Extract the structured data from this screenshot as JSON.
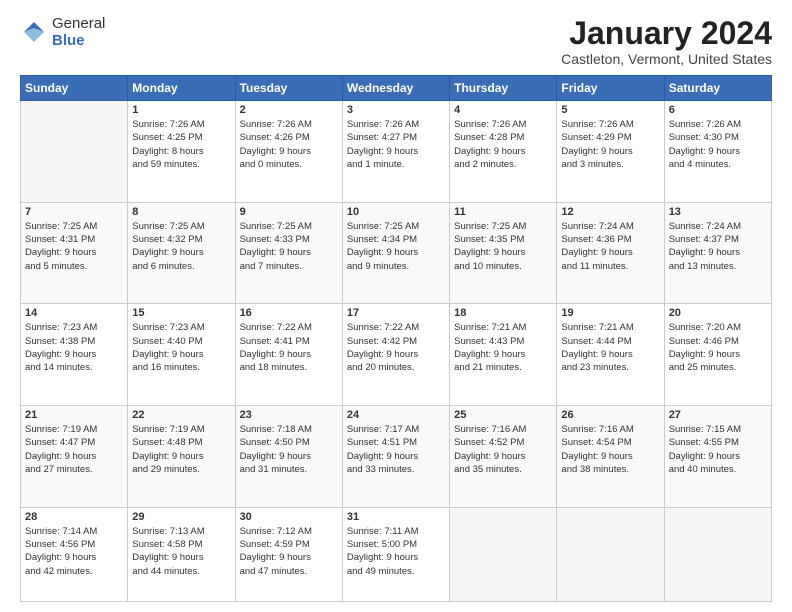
{
  "logo": {
    "general": "General",
    "blue": "Blue"
  },
  "title": "January 2024",
  "subtitle": "Castleton, Vermont, United States",
  "days_of_week": [
    "Sunday",
    "Monday",
    "Tuesday",
    "Wednesday",
    "Thursday",
    "Friday",
    "Saturday"
  ],
  "weeks": [
    [
      {
        "day": "",
        "info": ""
      },
      {
        "day": "1",
        "info": "Sunrise: 7:26 AM\nSunset: 4:25 PM\nDaylight: 8 hours\nand 59 minutes."
      },
      {
        "day": "2",
        "info": "Sunrise: 7:26 AM\nSunset: 4:26 PM\nDaylight: 9 hours\nand 0 minutes."
      },
      {
        "day": "3",
        "info": "Sunrise: 7:26 AM\nSunset: 4:27 PM\nDaylight: 9 hours\nand 1 minute."
      },
      {
        "day": "4",
        "info": "Sunrise: 7:26 AM\nSunset: 4:28 PM\nDaylight: 9 hours\nand 2 minutes."
      },
      {
        "day": "5",
        "info": "Sunrise: 7:26 AM\nSunset: 4:29 PM\nDaylight: 9 hours\nand 3 minutes."
      },
      {
        "day": "6",
        "info": "Sunrise: 7:26 AM\nSunset: 4:30 PM\nDaylight: 9 hours\nand 4 minutes."
      }
    ],
    [
      {
        "day": "7",
        "info": "Sunrise: 7:25 AM\nSunset: 4:31 PM\nDaylight: 9 hours\nand 5 minutes."
      },
      {
        "day": "8",
        "info": "Sunrise: 7:25 AM\nSunset: 4:32 PM\nDaylight: 9 hours\nand 6 minutes."
      },
      {
        "day": "9",
        "info": "Sunrise: 7:25 AM\nSunset: 4:33 PM\nDaylight: 9 hours\nand 7 minutes."
      },
      {
        "day": "10",
        "info": "Sunrise: 7:25 AM\nSunset: 4:34 PM\nDaylight: 9 hours\nand 9 minutes."
      },
      {
        "day": "11",
        "info": "Sunrise: 7:25 AM\nSunset: 4:35 PM\nDaylight: 9 hours\nand 10 minutes."
      },
      {
        "day": "12",
        "info": "Sunrise: 7:24 AM\nSunset: 4:36 PM\nDaylight: 9 hours\nand 11 minutes."
      },
      {
        "day": "13",
        "info": "Sunrise: 7:24 AM\nSunset: 4:37 PM\nDaylight: 9 hours\nand 13 minutes."
      }
    ],
    [
      {
        "day": "14",
        "info": "Sunrise: 7:23 AM\nSunset: 4:38 PM\nDaylight: 9 hours\nand 14 minutes."
      },
      {
        "day": "15",
        "info": "Sunrise: 7:23 AM\nSunset: 4:40 PM\nDaylight: 9 hours\nand 16 minutes."
      },
      {
        "day": "16",
        "info": "Sunrise: 7:22 AM\nSunset: 4:41 PM\nDaylight: 9 hours\nand 18 minutes."
      },
      {
        "day": "17",
        "info": "Sunrise: 7:22 AM\nSunset: 4:42 PM\nDaylight: 9 hours\nand 20 minutes."
      },
      {
        "day": "18",
        "info": "Sunrise: 7:21 AM\nSunset: 4:43 PM\nDaylight: 9 hours\nand 21 minutes."
      },
      {
        "day": "19",
        "info": "Sunrise: 7:21 AM\nSunset: 4:44 PM\nDaylight: 9 hours\nand 23 minutes."
      },
      {
        "day": "20",
        "info": "Sunrise: 7:20 AM\nSunset: 4:46 PM\nDaylight: 9 hours\nand 25 minutes."
      }
    ],
    [
      {
        "day": "21",
        "info": "Sunrise: 7:19 AM\nSunset: 4:47 PM\nDaylight: 9 hours\nand 27 minutes."
      },
      {
        "day": "22",
        "info": "Sunrise: 7:19 AM\nSunset: 4:48 PM\nDaylight: 9 hours\nand 29 minutes."
      },
      {
        "day": "23",
        "info": "Sunrise: 7:18 AM\nSunset: 4:50 PM\nDaylight: 9 hours\nand 31 minutes."
      },
      {
        "day": "24",
        "info": "Sunrise: 7:17 AM\nSunset: 4:51 PM\nDaylight: 9 hours\nand 33 minutes."
      },
      {
        "day": "25",
        "info": "Sunrise: 7:16 AM\nSunset: 4:52 PM\nDaylight: 9 hours\nand 35 minutes."
      },
      {
        "day": "26",
        "info": "Sunrise: 7:16 AM\nSunset: 4:54 PM\nDaylight: 9 hours\nand 38 minutes."
      },
      {
        "day": "27",
        "info": "Sunrise: 7:15 AM\nSunset: 4:55 PM\nDaylight: 9 hours\nand 40 minutes."
      }
    ],
    [
      {
        "day": "28",
        "info": "Sunrise: 7:14 AM\nSunset: 4:56 PM\nDaylight: 9 hours\nand 42 minutes."
      },
      {
        "day": "29",
        "info": "Sunrise: 7:13 AM\nSunset: 4:58 PM\nDaylight: 9 hours\nand 44 minutes."
      },
      {
        "day": "30",
        "info": "Sunrise: 7:12 AM\nSunset: 4:59 PM\nDaylight: 9 hours\nand 47 minutes."
      },
      {
        "day": "31",
        "info": "Sunrise: 7:11 AM\nSunset: 5:00 PM\nDaylight: 9 hours\nand 49 minutes."
      },
      {
        "day": "",
        "info": ""
      },
      {
        "day": "",
        "info": ""
      },
      {
        "day": "",
        "info": ""
      }
    ]
  ]
}
